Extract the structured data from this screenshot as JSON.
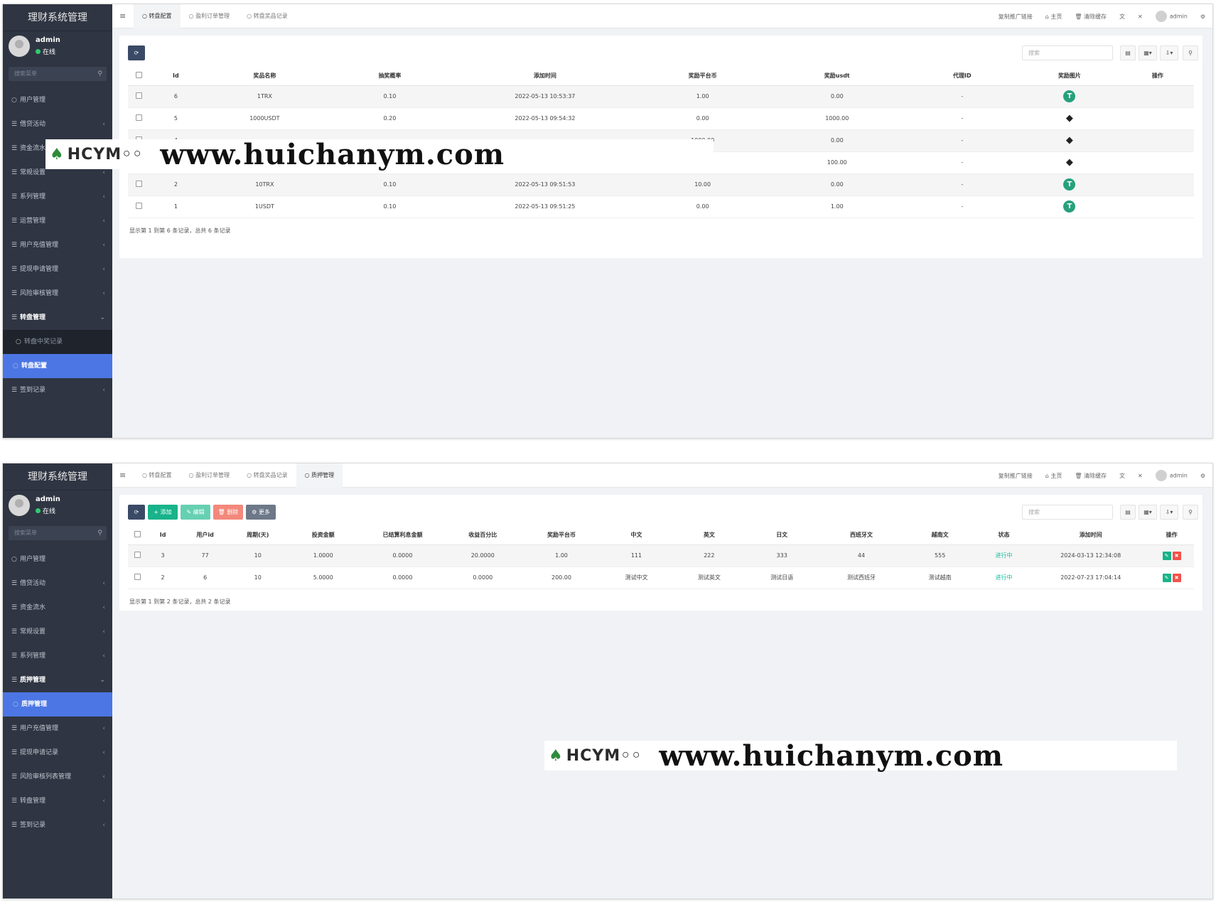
{
  "app": {
    "title": "理财系统管理",
    "user": "admin",
    "online": "在线",
    "menu_search_placeholder": "搜索菜单"
  },
  "topbar": {
    "right_items": [
      "复制推广链接",
      "主页",
      "清除缓存"
    ],
    "user": "admin"
  },
  "screen1": {
    "tabs": [
      "转盘配置",
      "盈利订单管理",
      "转盘奖品记录"
    ],
    "menu": [
      {
        "label": "用户管理",
        "type": "item"
      },
      {
        "label": "借贷活动",
        "type": "group"
      },
      {
        "label": "资金流水",
        "type": "group"
      },
      {
        "label": "常规设置",
        "type": "group"
      },
      {
        "label": "系列管理",
        "type": "group"
      },
      {
        "label": "运营管理",
        "type": "group"
      },
      {
        "label": "用户充值管理",
        "type": "group"
      },
      {
        "label": "提现申请管理",
        "type": "group"
      },
      {
        "label": "风险审核管理",
        "type": "group"
      },
      {
        "label": "转盘管理",
        "type": "open"
      },
      {
        "label": "转盘中奖记录",
        "type": "sub"
      },
      {
        "label": "转盘配置",
        "type": "active"
      },
      {
        "label": "签到记录",
        "type": "group"
      }
    ],
    "search_placeholder": "搜索",
    "columns": [
      "Id",
      "奖品名称",
      "抽奖概率",
      "添加时间",
      "奖励平台币",
      "奖励usdt",
      "代理ID",
      "奖励图片",
      "操作"
    ],
    "rows": [
      {
        "id": "6",
        "name": "1TRX",
        "prob": "0.10",
        "time": "2022-05-13 10:53:37",
        "coin": "1.00",
        "usdt": "0.00",
        "agent": "-",
        "img": "T"
      },
      {
        "id": "5",
        "name": "1000USDT",
        "prob": "0.20",
        "time": "2022-05-13 09:54:32",
        "coin": "0.00",
        "usdt": "1000.00",
        "agent": "-",
        "img": "E"
      },
      {
        "id": "4",
        "name": "",
        "prob": "",
        "time": "",
        "coin": "1000.00",
        "usdt": "0.00",
        "agent": "-",
        "img": "E"
      },
      {
        "id": "3",
        "name": "",
        "prob": "",
        "time": "",
        "coin": "0.00",
        "usdt": "100.00",
        "agent": "-",
        "img": "E"
      },
      {
        "id": "2",
        "name": "10TRX",
        "prob": "0.10",
        "time": "2022-05-13 09:51:53",
        "coin": "10.00",
        "usdt": "0.00",
        "agent": "-",
        "img": "T"
      },
      {
        "id": "1",
        "name": "1USDT",
        "prob": "0.10",
        "time": "2022-05-13 09:51:25",
        "coin": "0.00",
        "usdt": "1.00",
        "agent": "-",
        "img": "T"
      }
    ],
    "footer": "显示第 1 到第 6 条记录，总共 6 条记录"
  },
  "screen2": {
    "tabs": [
      "转盘配置",
      "盈利订单管理",
      "转盘奖品记录",
      "质押管理"
    ],
    "menu": [
      {
        "label": "用户管理",
        "type": "item"
      },
      {
        "label": "借贷活动",
        "type": "group"
      },
      {
        "label": "资金流水",
        "type": "group"
      },
      {
        "label": "常规设置",
        "type": "group"
      },
      {
        "label": "系列管理",
        "type": "group"
      },
      {
        "label": "质押管理",
        "type": "open"
      },
      {
        "label": "质押管理",
        "type": "active"
      },
      {
        "label": "用户充值管理",
        "type": "group"
      },
      {
        "label": "提现申请记录",
        "type": "group"
      },
      {
        "label": "风险审核列表管理",
        "type": "group"
      },
      {
        "label": "转盘管理",
        "type": "group"
      },
      {
        "label": "签到记录",
        "type": "group"
      }
    ],
    "buttons": {
      "add": "添加",
      "edit": "编辑",
      "delete": "删除",
      "more": "更多"
    },
    "search_placeholder": "搜索",
    "columns": [
      "Id",
      "用户id",
      "周期(天)",
      "投资金额",
      "已结算利息金额",
      "收益百分比",
      "奖励平台币",
      "中文",
      "英文",
      "日文",
      "西班牙文",
      "越南文",
      "状态",
      "添加时间",
      "操作"
    ],
    "rows": [
      {
        "id": "3",
        "uid": "77",
        "days": "10",
        "amount": "1.0000",
        "settled": "0.0000",
        "pct": "20.0000",
        "coin": "1.00",
        "zh": "111",
        "en": "222",
        "ja": "333",
        "es": "44",
        "vi": "555",
        "status": "进行中",
        "time": "2024-03-13 12:34:08"
      },
      {
        "id": "2",
        "uid": "6",
        "days": "10",
        "amount": "5.0000",
        "settled": "0.0000",
        "pct": "0.0000",
        "coin": "200.00",
        "zh": "测试中文",
        "en": "测试英文",
        "ja": "测试日语",
        "es": "测试西班牙",
        "vi": "测试越南",
        "status": "进行中",
        "time": "2022-07-23 17:04:14"
      }
    ],
    "footer": "显示第 1 到第 2 条记录，总共 2 条记录"
  },
  "watermark": {
    "logo_text": "HCYM",
    "url": "www.huichanym.com"
  }
}
